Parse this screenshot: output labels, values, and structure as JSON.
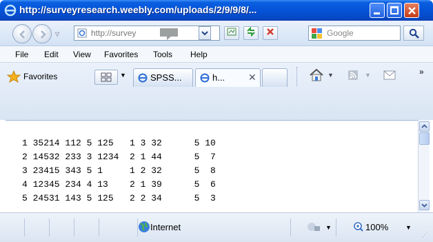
{
  "window": {
    "title": "http://surveyresearch.weebly.com/uploads/2/9/9/8/..."
  },
  "address_bar": {
    "url": "http://survey"
  },
  "search": {
    "placeholder": "Google"
  },
  "menu": [
    "File",
    "Edit",
    "View",
    "Favorites",
    "Tools",
    "Help"
  ],
  "favorites_label": "Favorites",
  "tabs": [
    {
      "label": "SPSS..."
    },
    {
      "label": "h...",
      "active": true
    }
  ],
  "data_lines": [
    "1 35214 112 5 125   1 3 32      5 10",
    "2 14532 233 3 1234  2 1 44      5  7",
    "3 23415 343 5 1     1 2 32      5  8",
    "4 12345 234 4 13    2 1 39      5  6",
    "5 24531 143 5 125   2 2 34      5  3"
  ],
  "status": {
    "zone": "Internet",
    "zoom": "100%"
  },
  "colors": {
    "titlebar": "#0553d8",
    "chrome": "#d3e2f4"
  }
}
